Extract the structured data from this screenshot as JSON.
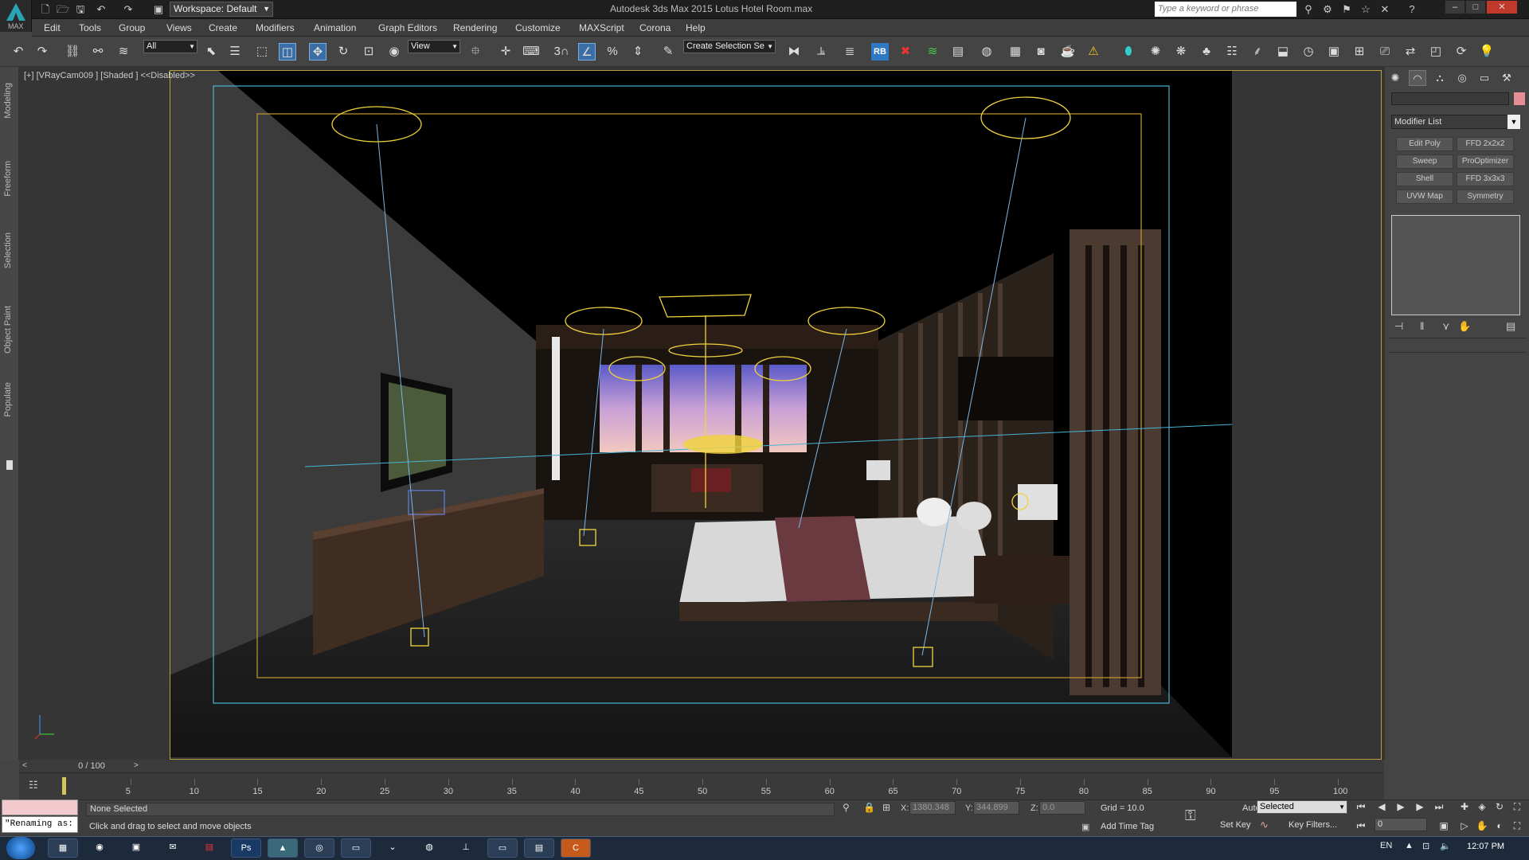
{
  "app": {
    "title": "Autodesk 3ds Max 2015    Lotus Hotel Room.max",
    "logo_label": "MAX",
    "workspace": "Workspace: Default",
    "search_placeholder": "Type a keyword or phrase"
  },
  "menu": [
    "Edit",
    "Tools",
    "Group",
    "Views",
    "Create",
    "Modifiers",
    "Animation",
    "Graph Editors",
    "Rendering",
    "Customize",
    "MAXScript",
    "Corona",
    "Help"
  ],
  "toolbar": {
    "selection_filter": "All",
    "ref_coord": "View",
    "snap_3": "3",
    "selection_set": "Create Selection Se"
  },
  "side_tabs": [
    "Modeling",
    "Freeform",
    "Selection",
    "Object Paint",
    "Populate"
  ],
  "viewport": {
    "label": "[+] [VRayCam009 ] [Shaded ]  <<Disabled>>"
  },
  "command_panel": {
    "modifier_list": "Modifier List",
    "modifiers": [
      "Edit Poly",
      "FFD 2x2x2",
      "Sweep",
      "ProOptimizer",
      "Shell",
      "FFD 3x3x3",
      "UVW Map",
      "Symmetry"
    ]
  },
  "timeline": {
    "frame_label": "0 / 100",
    "ticks": [
      "5",
      "10",
      "15",
      "20",
      "25",
      "30",
      "35",
      "40",
      "45",
      "50",
      "55",
      "60",
      "65",
      "70",
      "75",
      "80",
      "85",
      "90",
      "95",
      "100"
    ]
  },
  "status": {
    "maxscript_text": "\"Renaming as:",
    "selection": "None Selected",
    "prompt": "Click and drag to select and move objects",
    "x_label": "X:",
    "x_value": "1380.348",
    "y_label": "Y:",
    "y_value": "344.899",
    "z_label": "Z:",
    "z_value": "0.0",
    "grid": "Grid = 10.0",
    "add_time_tag": "Add Time Tag",
    "auto_key": "Auto Key",
    "set_key": "Set Key",
    "key_mode": "Selected",
    "key_filters": "Key Filters...",
    "current_frame": "0"
  },
  "taskbar": {
    "lang": "EN",
    "time": "12:07 PM",
    "apps": [
      "explorer-icon",
      "chrome-icon",
      "store-icon",
      "outlook-icon",
      "acrobat-icon",
      "photoshop-icon",
      "3dsmax-icon",
      "app-icon",
      "folder-icon",
      "vray-icon",
      "skype-icon",
      "tool-icon",
      "screen-icon",
      "window-icon",
      "corona-icon"
    ]
  }
}
